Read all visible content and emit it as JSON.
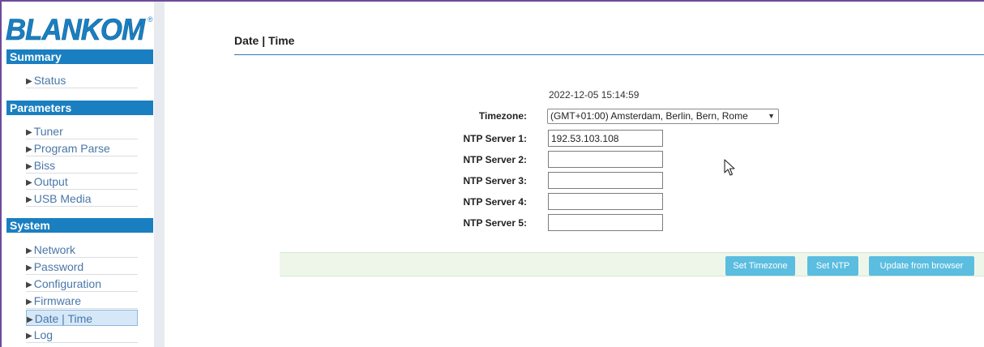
{
  "brand": {
    "logo_text": "BLANKOM",
    "logo_mark": "®",
    "logo_color": "#1a7fc1"
  },
  "sidebar": {
    "sections": [
      {
        "title": "Summary",
        "items": [
          "Status"
        ]
      },
      {
        "title": "Parameters",
        "items": [
          "Tuner",
          "Program Parse",
          "Biss",
          "Output",
          "USB Media"
        ]
      },
      {
        "title": "System",
        "items": [
          "Network",
          "Password",
          "Configuration",
          "Firmware",
          "Date | Time",
          "Log"
        ]
      }
    ],
    "active_item": "Date | Time"
  },
  "page": {
    "title": "Date | Time",
    "current_datetime": "2022-12-05 15:14:59",
    "fields": {
      "timezone_label": "Timezone:",
      "timezone_value": "(GMT+01:00) Amsterdam, Berlin, Bern, Rome",
      "ntp_labels": [
        "NTP Server 1:",
        "NTP Server 2:",
        "NTP Server 3:",
        "NTP Server 4:",
        "NTP Server 5:"
      ],
      "ntp_values": [
        "192.53.103.108",
        "",
        "",
        "",
        ""
      ]
    },
    "buttons": {
      "set_timezone": "Set Timezone",
      "set_ntp": "Set NTP",
      "update_from_browser": "Update from browser"
    }
  },
  "colors": {
    "section_header": "#1a7fc1",
    "button": "#5bbde0",
    "button_bar": "#eef6ea",
    "link": "#4a77a8",
    "frame": "#6d4a9a"
  }
}
